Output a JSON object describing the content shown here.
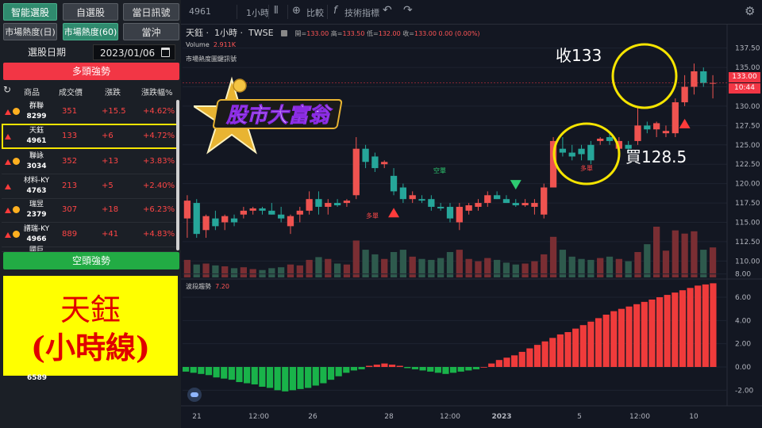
{
  "left_panel": {
    "tabs_row1": [
      "智能選股",
      "自選股",
      "當日訊號"
    ],
    "tabs_row2": [
      "市場熱度(日)",
      "市場熱度(60)",
      "當沖"
    ],
    "date_label": "選股日期",
    "date_value": "2023/01/06",
    "bull_header": "多頭強勢",
    "bear_header": "空頭強勢",
    "columns": [
      "商品",
      "成交價",
      "漲跌",
      "漲跌幅%"
    ],
    "rows": [
      {
        "name": "群聯",
        "code": "8299",
        "price": "351",
        "change": "+15.5",
        "pct": "+4.62%",
        "coin": true
      },
      {
        "name": "天鈺",
        "code": "4961",
        "price": "133",
        "change": "+6",
        "pct": "+4.72%",
        "coin": false
      },
      {
        "name": "聯詠",
        "code": "3034",
        "price": "352",
        "change": "+13",
        "pct": "+3.83%",
        "coin": true
      },
      {
        "name": "材料-KY",
        "code": "4763",
        "price": "213",
        "change": "+5",
        "pct": "+2.40%",
        "coin": false
      },
      {
        "name": "瑞昱",
        "code": "2379",
        "price": "307",
        "change": "+18",
        "pct": "+6.23%",
        "coin": true
      },
      {
        "name": "譜瑞-KY",
        "code": "4966",
        "price": "889",
        "change": "+41",
        "pct": "+4.83%",
        "coin": true
      },
      {
        "name": "國巨",
        "code": "",
        "price": "",
        "change": "",
        "pct": "",
        "coin": true
      }
    ],
    "overlay_line1": "天鈺",
    "overlay_line2": "(小時線)",
    "bottom_code": "6589"
  },
  "toolbar": {
    "symbol": "4961",
    "interval": "1小時",
    "compare": "比較",
    "indicators": "技術指標"
  },
  "chart": {
    "name": "天鈺",
    "interval": "1小時",
    "exchange": "TWSE",
    "ohlc_open_label": "開",
    "ohlc_open": "133.00",
    "ohlc_high_label": "高",
    "ohlc_high": "133.50",
    "ohlc_low_label": "低",
    "ohlc_low": "132.00",
    "ohlc_close_label": "收",
    "ohlc_close": "133.00",
    "ohlc_change": "0.00 (0.00%)",
    "volume_label": "Volume",
    "volume_value": "2.911K",
    "signal_label": "市場熱度圖鍵訊號",
    "osc_label": "波段趨勢",
    "osc_value": "7.20",
    "price_tag": "133.00",
    "time_tag": "10:44",
    "logo_text": "股市大富翁",
    "annotation_close": "收133",
    "annotation_buy": "買128.5",
    "signal_long": "多單",
    "signal_short": "空單",
    "price_ticks": [
      "137.50",
      "135.00",
      "132.50",
      "130.00",
      "127.50",
      "125.00",
      "122.50",
      "120.00",
      "117.50",
      "115.00",
      "112.50",
      "110.00"
    ],
    "osc_ticks": [
      "8.00",
      "6.00",
      "4.00",
      "2.00",
      "0.00",
      "-2.00"
    ],
    "x_ticks": [
      "21",
      "12:00",
      "26",
      "28",
      "12:00",
      "2023",
      "5",
      "12:00",
      "10"
    ],
    "colors": {
      "up": "#ef5350",
      "down": "#26a69a",
      "bg": "#131722",
      "highlight": "#f5e400"
    }
  },
  "chart_data": {
    "type": "candlestick",
    "title": "",
    "ylim": [
      108.5,
      139
    ],
    "candles": [
      {
        "o": 115.5,
        "h": 118.5,
        "l": 113,
        "c": 117.8
      },
      {
        "o": 117.5,
        "h": 118,
        "l": 113,
        "c": 113.5
      },
      {
        "o": 114,
        "h": 116,
        "l": 113,
        "c": 115.8
      },
      {
        "o": 115.5,
        "h": 116.5,
        "l": 114,
        "c": 114.5
      },
      {
        "o": 115,
        "h": 116,
        "l": 114,
        "c": 115.8
      },
      {
        "o": 115.5,
        "h": 116,
        "l": 114.5,
        "c": 115
      },
      {
        "o": 116,
        "h": 117,
        "l": 115.5,
        "c": 116.5
      },
      {
        "o": 116.5,
        "h": 117,
        "l": 116,
        "c": 116.8
      },
      {
        "o": 116.8,
        "h": 117,
        "l": 116,
        "c": 116.5
      },
      {
        "o": 116.5,
        "h": 117.5,
        "l": 116,
        "c": 116
      },
      {
        "o": 116,
        "h": 117,
        "l": 115,
        "c": 115.5
      },
      {
        "o": 114.5,
        "h": 116,
        "l": 113.5,
        "c": 115.8
      },
      {
        "o": 116,
        "h": 117,
        "l": 115,
        "c": 116.5
      },
      {
        "o": 116.5,
        "h": 119,
        "l": 116,
        "c": 118
      },
      {
        "o": 118,
        "h": 119,
        "l": 116,
        "c": 117
      },
      {
        "o": 117,
        "h": 118,
        "l": 116,
        "c": 117.5
      },
      {
        "o": 117.5,
        "h": 118,
        "l": 117,
        "c": 117.2
      },
      {
        "o": 117.5,
        "h": 118,
        "l": 117,
        "c": 117.8
      },
      {
        "o": 118.5,
        "h": 126,
        "l": 118,
        "c": 124.5
      },
      {
        "o": 124.5,
        "h": 125,
        "l": 122,
        "c": 122.8
      },
      {
        "o": 123.5,
        "h": 124,
        "l": 121.5,
        "c": 122
      },
      {
        "o": 122.5,
        "h": 123,
        "l": 122,
        "c": 122.8
      },
      {
        "o": 121,
        "h": 122,
        "l": 118.5,
        "c": 119
      },
      {
        "o": 119.5,
        "h": 120,
        "l": 117.5,
        "c": 118
      },
      {
        "o": 118,
        "h": 119,
        "l": 117.5,
        "c": 118.5
      },
      {
        "o": 118,
        "h": 118.5,
        "l": 117.5,
        "c": 117.8
      },
      {
        "o": 118,
        "h": 118.5,
        "l": 116.5,
        "c": 117
      },
      {
        "o": 117,
        "h": 117.5,
        "l": 116.5,
        "c": 116.8
      },
      {
        "o": 117,
        "h": 117.5,
        "l": 115,
        "c": 115.5
      },
      {
        "o": 115,
        "h": 117.5,
        "l": 114,
        "c": 117
      },
      {
        "o": 116.5,
        "h": 117.5,
        "l": 116,
        "c": 117.2
      },
      {
        "o": 117,
        "h": 118,
        "l": 116.5,
        "c": 117.5
      },
      {
        "o": 117.5,
        "h": 119,
        "l": 117,
        "c": 118.5
      },
      {
        "o": 118.5,
        "h": 119,
        "l": 118,
        "c": 118
      },
      {
        "o": 118,
        "h": 118.5,
        "l": 117.5,
        "c": 117.5
      },
      {
        "o": 117.5,
        "h": 118,
        "l": 117,
        "c": 117.2
      },
      {
        "o": 117.2,
        "h": 118,
        "l": 117,
        "c": 117.5
      },
      {
        "o": 117,
        "h": 118,
        "l": 116,
        "c": 117.5
      },
      {
        "o": 116,
        "h": 120,
        "l": 115.5,
        "c": 119.5
      },
      {
        "o": 119.5,
        "h": 126,
        "l": 119.5,
        "c": 125.5
      },
      {
        "o": 124.5,
        "h": 126,
        "l": 123.5,
        "c": 124
      },
      {
        "o": 124,
        "h": 125,
        "l": 123,
        "c": 123.5
      },
      {
        "o": 124.5,
        "h": 125,
        "l": 123,
        "c": 123.8
      },
      {
        "o": 125,
        "h": 125.5,
        "l": 122.5,
        "c": 123
      },
      {
        "o": 125.5,
        "h": 126,
        "l": 125,
        "c": 125.8
      },
      {
        "o": 126,
        "h": 126.5,
        "l": 125,
        "c": 125.5
      },
      {
        "o": 124.5,
        "h": 126,
        "l": 124,
        "c": 125.5
      },
      {
        "o": 125,
        "h": 125.5,
        "l": 124,
        "c": 124.5
      },
      {
        "o": 125.5,
        "h": 130,
        "l": 125,
        "c": 127.5
      },
      {
        "o": 127.5,
        "h": 128,
        "l": 126.5,
        "c": 127
      },
      {
        "o": 127,
        "h": 128,
        "l": 126,
        "c": 127.8
      },
      {
        "o": 126.5,
        "h": 127.5,
        "l": 126,
        "c": 126.8
      },
      {
        "o": 126.5,
        "h": 131,
        "l": 126,
        "c": 130.5
      },
      {
        "o": 130.5,
        "h": 134,
        "l": 130,
        "c": 132.5
      },
      {
        "o": 132.5,
        "h": 135.5,
        "l": 131.5,
        "c": 134.5
      },
      {
        "o": 134.5,
        "h": 135,
        "l": 132.5,
        "c": 133
      },
      {
        "o": 133,
        "h": 134,
        "l": 131,
        "c": 133
      }
    ],
    "volume": [
      38,
      28,
      30,
      26,
      24,
      20,
      22,
      18,
      16,
      20,
      22,
      28,
      26,
      38,
      44,
      40,
      30,
      28,
      80,
      60,
      50,
      40,
      55,
      60,
      45,
      40,
      38,
      42,
      55,
      60,
      40,
      35,
      42,
      38,
      32,
      28,
      30,
      35,
      50,
      88,
      60,
      45,
      40,
      38,
      42,
      45,
      40,
      35,
      55,
      72,
      110,
      58,
      102,
      95,
      100,
      60,
      65
    ],
    "oscillator": [
      -0.4,
      -0.5,
      -0.6,
      -0.7,
      -0.9,
      -1.0,
      -1.1,
      -1.3,
      -1.4,
      -1.5,
      -1.7,
      -1.8,
      -2.0,
      -2.1,
      -2.0,
      -1.9,
      -1.8,
      -1.6,
      -1.4,
      -1.1,
      -0.8,
      -0.5,
      -0.3,
      -0.2,
      0.1,
      0.2,
      0.3,
      0.2,
      0.1,
      -0.1,
      -0.2,
      -0.3,
      -0.4,
      -0.5,
      -0.6,
      -0.5,
      -0.4,
      -0.3,
      -0.2,
      0.0,
      0.3,
      0.6,
      0.8,
      1.0,
      1.3,
      1.6,
      1.9,
      2.2,
      2.5,
      2.8,
      3.0,
      3.3,
      3.6,
      3.9,
      4.2,
      4.5,
      4.8,
      5.0,
      5.2,
      5.4,
      5.6,
      5.8,
      6.0,
      6.2,
      6.4,
      6.6,
      6.8,
      7.0,
      7.1,
      7.2
    ],
    "signals": [
      {
        "index": 22,
        "side": "long"
      },
      {
        "index": 35,
        "side": "short"
      },
      {
        "index": 53,
        "side": "long"
      }
    ]
  }
}
